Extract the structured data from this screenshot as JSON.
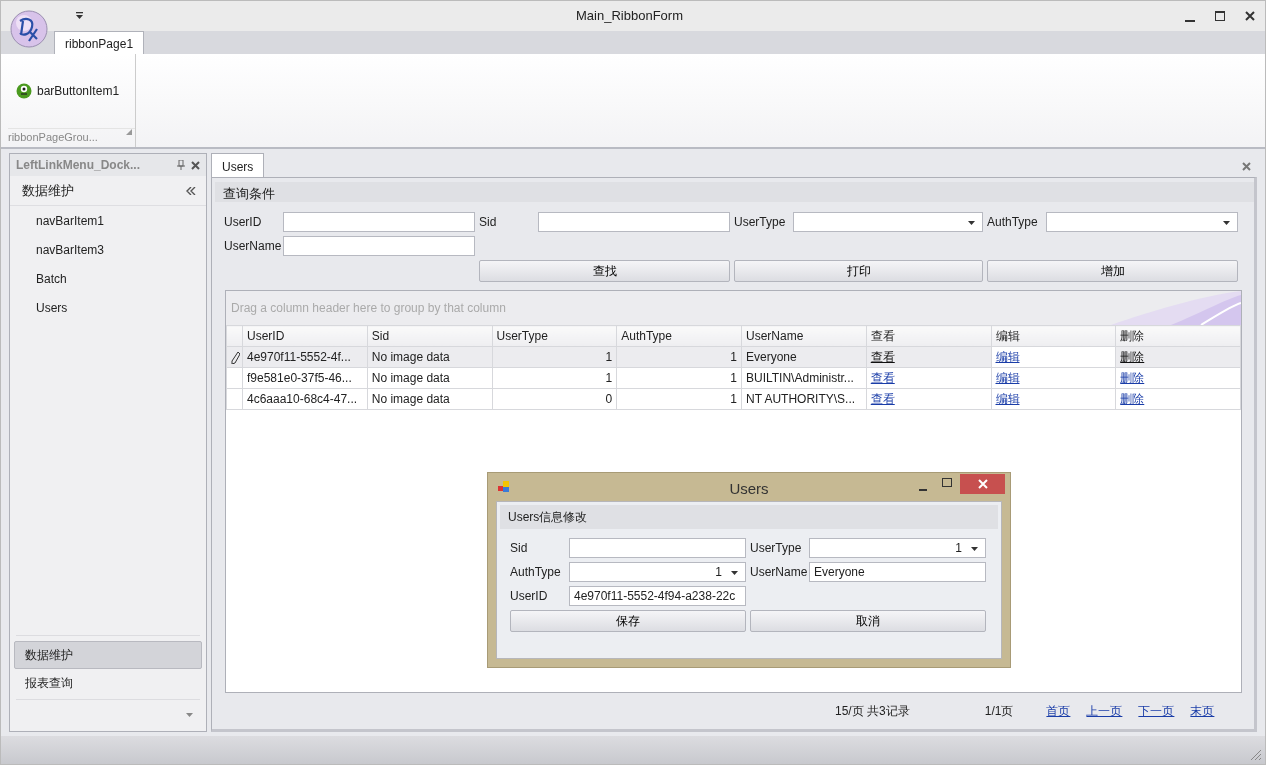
{
  "window": {
    "title": "Main_RibbonForm"
  },
  "ribbon": {
    "tabs": [
      {
        "label": "ribbonPage1",
        "selected": true
      }
    ],
    "groups": [
      {
        "caption": "ribbonPageGrou...",
        "items": [
          {
            "label": "barButtonItem1"
          }
        ]
      }
    ]
  },
  "left_panel": {
    "title": "LeftLinkMenu_Dock...",
    "group": {
      "caption": "数据维护",
      "items": [
        "navBarItem1",
        "navBarItem3",
        "Batch",
        "Users"
      ]
    },
    "group_buttons": [
      {
        "label": "数据维护",
        "selected": true
      },
      {
        "label": "报表查询",
        "selected": false
      }
    ]
  },
  "document_tabs": [
    {
      "label": "Users",
      "selected": true
    }
  ],
  "search_panel": {
    "title": "查询条件",
    "fields": [
      {
        "label": "UserID",
        "kind": "text"
      },
      {
        "label": "Sid",
        "kind": "text"
      },
      {
        "label": "UserType",
        "kind": "combo"
      },
      {
        "label": "AuthType",
        "kind": "combo"
      },
      {
        "label": "UserName",
        "kind": "text"
      }
    ],
    "buttons": [
      "查找",
      "打印",
      "增加"
    ]
  },
  "grid": {
    "group_hint": "Drag a column header here to group by that column",
    "columns": [
      "UserID",
      "Sid",
      "UserType",
      "AuthType",
      "UserName",
      "查看",
      "编辑",
      "删除"
    ],
    "rows": [
      {
        "selected": true,
        "editing": true,
        "cells": [
          "4e970f11-5552-4f...",
          "No image data",
          "1",
          "1",
          "Everyone"
        ],
        "links": [
          {
            "text": "查看",
            "focused": false
          },
          {
            "text": "编辑",
            "focused": true
          },
          {
            "text": "删除",
            "focused": false
          }
        ]
      },
      {
        "selected": false,
        "editing": false,
        "cells": [
          "f9e581e0-37f5-46...",
          "No image data",
          "1",
          "1",
          "BUILTIN\\Administr..."
        ],
        "links": [
          {
            "text": "查看"
          },
          {
            "text": "编辑"
          },
          {
            "text": "删除"
          }
        ]
      },
      {
        "selected": false,
        "editing": false,
        "cells": [
          "4c6aaa10-68c4-47...",
          "No image data",
          "0",
          "1",
          "NT AUTHORITY\\S..."
        ],
        "links": [
          {
            "text": "查看"
          },
          {
            "text": "编辑"
          },
          {
            "text": "删除"
          }
        ]
      }
    ]
  },
  "pager": {
    "page_size": "15/页 共3记录",
    "page": "1/1页",
    "links": [
      "首页",
      "上一页",
      "下一页",
      "末页"
    ]
  },
  "dialog": {
    "title": "Users",
    "group_title": "Users信息修改",
    "fields": [
      {
        "label": "Sid",
        "kind": "text"
      },
      {
        "label": "UserType",
        "kind": "combo",
        "value": "1"
      },
      {
        "label": "AuthType",
        "kind": "combo",
        "value": "1"
      },
      {
        "label": "UserName",
        "kind": "text",
        "value": "Everyone"
      },
      {
        "label": "UserID",
        "kind": "text",
        "value": "4e970f11-5552-4f94-a238-22c"
      }
    ],
    "buttons": [
      "保存",
      "取消"
    ]
  }
}
